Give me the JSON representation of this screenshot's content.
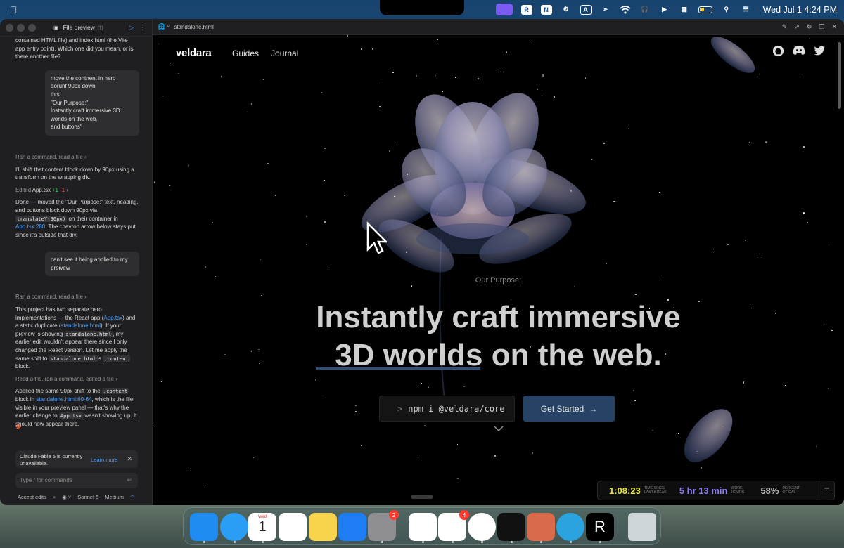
{
  "menubar": {
    "clock": "Wed Jul 1  4:24 PM",
    "tray_letters": [
      "R",
      "N",
      "A"
    ]
  },
  "left_panel": {
    "title": "File preview",
    "messages": [
      {
        "type": "assistant",
        "text": "contained HTML file) and index.html (the Vite app entry point). Which one did you mean, or is there another file?"
      },
      {
        "type": "user",
        "text": "move the contnent in hero\naorunf 90px down\nthis\n\"Our Purpose:\"\nInstantly craft immersive 3D worlds on the web.\nand buttons\""
      },
      {
        "type": "meta",
        "text": "Ran a command, read a file"
      },
      {
        "type": "assistant",
        "text": "I'll shift that content block down by 90px using a transform on the wrapping div."
      },
      {
        "type": "edit",
        "prefix": "Edited",
        "file": "App.tsx",
        "plus": "+1",
        "minus": "-1"
      },
      {
        "type": "assistant_done",
        "p1": "Done — moved the \"Our Purpose:\" text, heading, and buttons block down 90px via",
        "code1": "translateY(90px)",
        "p2": "on their container in",
        "link1": "App.tsx:280",
        "p3": ". The chevron arrow below stays put since it's outside that div."
      },
      {
        "type": "user",
        "text": "can't see it being applied to my preivew"
      },
      {
        "type": "meta",
        "text": "Ran a command, read a file"
      },
      {
        "type": "assistant_two",
        "p1": "This project has two separate hero implementations — the React app (",
        "link1": "App.tsx",
        "p2": ") and a static duplicate (",
        "link2": "standalone.html",
        "p3": "). If your preview is showing",
        "code1": "standalone.html",
        "p4": ", my earlier edit wouldn't appear there since I only changed the React version. Let me apply the same shift to",
        "code2": "standalone.html",
        "p5": "'s",
        "code3": ".content",
        "p6": "block."
      },
      {
        "type": "meta",
        "text": "Read a file, ran a command, edited a file"
      },
      {
        "type": "assistant_final",
        "p1": "Applied the same 90px shift to the",
        "code1": ".content",
        "p2": "block in",
        "link1": "standalone.html:60-64",
        "p3": ", which is the file visible in your preview panel — that's why the earlier change to",
        "code2": "App.tsx",
        "p4": "wasn't showing up. It should now appear there."
      }
    ],
    "notice": {
      "text": "Claude Fable 5 is currently unavailable.",
      "link": "Learn more"
    },
    "command_placeholder": "Type / for commands",
    "footer": {
      "accept": "Accept edits",
      "plus": "+",
      "model": "Sonnet 5",
      "effort": "Medium"
    }
  },
  "browser": {
    "url": "standalone.html"
  },
  "site": {
    "logo": "veldara",
    "nav": [
      "Guides",
      "Journal"
    ],
    "social_icons": [
      "github-icon",
      "discord-icon",
      "twitter-icon"
    ],
    "eyebrow": "Our Purpose:",
    "headline_line1": "Instantly craft immersive",
    "headline_line2a": "3D worlds",
    "headline_line2b": " on the web.",
    "npm_prompt": ">",
    "npm_command": "npm i @veldara/core",
    "cta": "Get Started",
    "cta_arrow": "→"
  },
  "timer_widget": {
    "since_break": "1:08:23",
    "since_break_label": "TIME SINCE LAST BREAK",
    "work_hours": "5 hr 13 min",
    "work_hours_label": "WORK HOURS",
    "percent": "58%",
    "percent_label": "PERCENT OF DAY"
  },
  "dock": {
    "apps": [
      {
        "name": "finder",
        "color": "#1e8cf0"
      },
      {
        "name": "safari",
        "color": "#2a9df4"
      },
      {
        "name": "calendar",
        "color": "#ffffff",
        "label_top": "Wed",
        "label": "1"
      },
      {
        "name": "reminders",
        "color": "#ffffff"
      },
      {
        "name": "notes",
        "color": "#f7d44c"
      },
      {
        "name": "app-store",
        "color": "#1e7df2"
      },
      {
        "name": "system-settings",
        "color": "#8e8e93",
        "badge": "2"
      },
      {
        "name": "vo",
        "color": "#ffffff"
      },
      {
        "name": "notion",
        "color": "#ffffff",
        "badge": "4"
      },
      {
        "name": "chrome",
        "color": "#ffffff"
      },
      {
        "name": "figma",
        "color": "#111111"
      },
      {
        "name": "claude",
        "color": "#d96b4a"
      },
      {
        "name": "telegram",
        "color": "#2aa3df"
      },
      {
        "name": "r-app",
        "color": "#000000",
        "label": "R"
      },
      {
        "name": "trash",
        "color": "#cfd6da"
      }
    ]
  }
}
